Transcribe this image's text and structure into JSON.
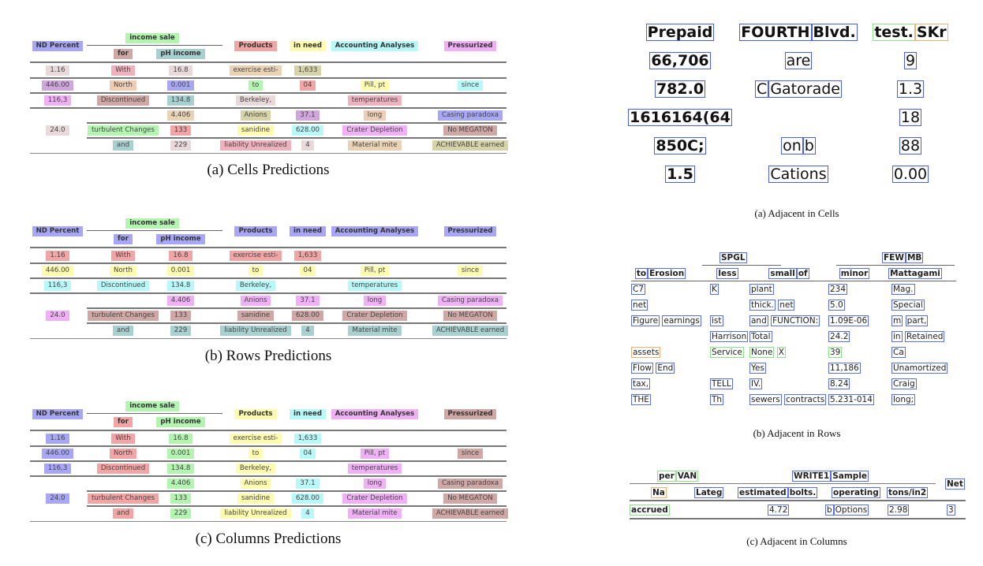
{
  "figures": {
    "cells": {
      "caption": "(a) Cells Predictions",
      "header": {
        "nd_percent": "ND Percent",
        "income_sale": "income sale",
        "for": "for",
        "ph_income": "pH income",
        "products": "Products",
        "in_need": "in need",
        "accounting": "Accounting Analyses",
        "pressurized": "Pressurized"
      },
      "rows": [
        [
          "1.16",
          "With",
          "16.8",
          "exercise esti-",
          "1,633",
          "",
          ""
        ],
        [
          "446.00",
          "North",
          "0.001",
          "to",
          "04",
          "Pill, pt",
          "since"
        ],
        [
          "116,3",
          "Discontinued",
          "134.8",
          "Berkeley,",
          "",
          "temperatures",
          ""
        ],
        [
          "",
          "",
          "4.406",
          "Anions",
          "37.1",
          "long",
          "Casing paradoxa"
        ],
        [
          "24.0",
          "turbulent Changes",
          "133",
          "sanidine",
          "628.00",
          "Crater Depletion",
          "No MEGATON"
        ],
        [
          "",
          "and",
          "229",
          "liability Unrealized",
          "4",
          "Material mite",
          "ACHIEVABLE earned"
        ]
      ]
    },
    "rows_pred": {
      "caption": "(b) Rows Predictions"
    },
    "columns_pred": {
      "caption": "(c) Columns Predictions"
    },
    "adjacent_cells": {
      "caption": "(a) Adjacent in Cells",
      "header": [
        "Prepaid",
        "FOURTH Blvd.",
        "test. SKr"
      ],
      "rows": [
        [
          "66,706",
          "are",
          "9"
        ],
        [
          "782.0",
          "C Gatorade",
          "1.3"
        ],
        [
          "1616164(64",
          "",
          "18"
        ],
        [
          "850C;",
          "on b",
          "88"
        ],
        [
          "1.5",
          "Cations",
          "0.00"
        ]
      ]
    },
    "adjacent_rows": {
      "caption": "(b) Adjacent in Rows",
      "group_headers": [
        "SPGL",
        "FEW MB"
      ],
      "header": [
        "to Erosion",
        "less",
        "small of",
        "minor",
        "Mattagami"
      ],
      "rows": [
        [
          "C7",
          "K",
          "plant",
          "234",
          "Mag."
        ],
        [
          "net",
          "",
          "thick. net",
          "5.0",
          "Special"
        ],
        [
          "Figure earnings",
          "ist",
          "and FUNCTION:",
          "1.09E-06",
          "m part,"
        ],
        [
          "",
          "Harrison",
          "Total",
          "24.2",
          "in Retained"
        ],
        [
          "assets",
          "Service",
          "None X",
          "39",
          "Ca"
        ],
        [
          "Flow End",
          "",
          "Yes",
          "11,186",
          "Unamortized"
        ],
        [
          "tax,",
          "TELL",
          "IV.",
          "8.24",
          "Craig"
        ],
        [
          "THE",
          "Th",
          "sewers contracts",
          "5.231-014",
          "long;"
        ]
      ]
    },
    "adjacent_columns": {
      "caption": "(c) Adjacent in Columns",
      "group_headers": [
        "per VAN",
        "WRITE1 Sample",
        "Net"
      ],
      "header": [
        "Na",
        "Lateg",
        "estimated bolts.",
        "operating",
        "tons/in2"
      ],
      "rows": [
        [
          "accrued",
          "",
          "4.72",
          "b Options",
          "2.98",
          "3"
        ]
      ]
    }
  },
  "colors": {
    "blue": "#a7a7f5",
    "green": "#b3f5b0",
    "red": "#f2a5a5",
    "yellow": "#fdfbb0",
    "cyan": "#b8f8f8",
    "magenta": "#f0b0f5",
    "brown": "#cfa7a5",
    "teal": "#a9d0d0",
    "tan": "#ead3b5",
    "olive": "#d6d3a8",
    "pink": "#edb2bd",
    "lightpink": "#ead9da",
    "purple": "#d0a7dc",
    "peach": "#efcdb4"
  }
}
